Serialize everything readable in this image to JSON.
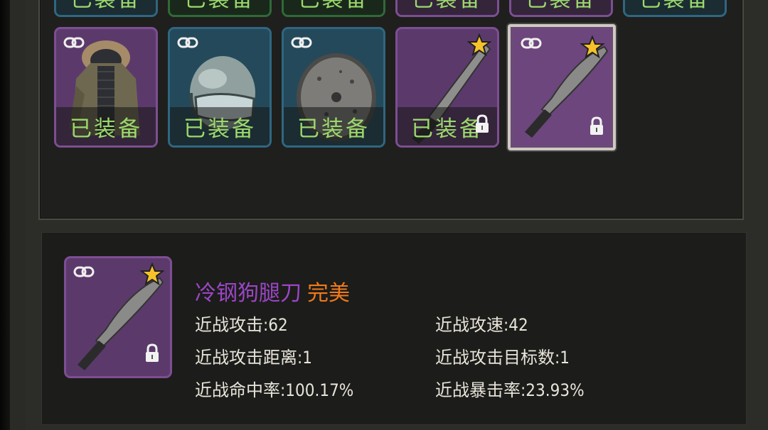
{
  "inventory": {
    "equipped_label": "已装备",
    "top_row_slots": [
      {
        "rarity": "blue"
      },
      {
        "rarity": "green"
      },
      {
        "rarity": "green"
      },
      {
        "rarity": "purple"
      },
      {
        "rarity": "purple"
      },
      {
        "rarity": "blue"
      }
    ],
    "items": [
      {
        "icon": "fur-parka-icon",
        "rarity": "purple",
        "equipped": true,
        "bound": true,
        "starred": false,
        "locked": false
      },
      {
        "icon": "motorcycle-helmet-icon",
        "rarity": "blue",
        "equipped": true,
        "bound": true,
        "starred": false,
        "locked": false
      },
      {
        "icon": "round-shield-icon",
        "rarity": "blue",
        "equipped": true,
        "bound": true,
        "starred": false,
        "locked": false
      },
      {
        "icon": "machete-icon",
        "rarity": "purple",
        "equipped": true,
        "bound": false,
        "starred": true,
        "locked": true
      },
      {
        "icon": "kukri-knife-icon",
        "rarity": "purple",
        "equipped": false,
        "bound": true,
        "starred": true,
        "locked": true,
        "selected": true
      }
    ]
  },
  "detail": {
    "name": "冷钢狗腿刀",
    "quality": "完美",
    "colors": {
      "name": "#9a46c4",
      "quality": "#f07a1a",
      "equipped_text": "#9bd96b",
      "stat_text": "#e8e4da"
    },
    "stats": [
      {
        "label": "近战攻击",
        "value": "62"
      },
      {
        "label": "近战攻速",
        "value": "42"
      },
      {
        "label": "近战攻击距离",
        "value": "1"
      },
      {
        "label": "近战攻击目标数",
        "value": "1"
      },
      {
        "label": "近战命中率",
        "value": "100.17%"
      },
      {
        "label": "近战暴击率",
        "value": "23.93%"
      }
    ],
    "stat_texts": {
      "melee_attack": "近战攻击:62",
      "melee_speed": "近战攻速:42",
      "melee_range": "近战攻击距离:1",
      "melee_targets": "近战攻击目标数:1",
      "melee_hit": "近战命中率:100.17%",
      "melee_crit": "近战暴击率:23.93%"
    }
  }
}
